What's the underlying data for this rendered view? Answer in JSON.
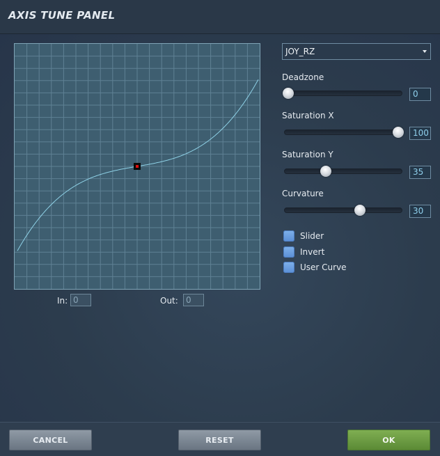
{
  "header": {
    "title": "AXIS TUNE PANEL"
  },
  "graph": {
    "in_label": "In:",
    "in_value": "0",
    "out_label": "Out:",
    "out_value": "0",
    "curve_color": "#8ed1e6",
    "marker_color": "#e01010"
  },
  "axis_select": {
    "selected": "JOY_RZ"
  },
  "params": [
    {
      "label": "Deadzone",
      "value": "0",
      "level": 0.03
    },
    {
      "label": "Saturation X",
      "value": "100",
      "level": 0.97
    },
    {
      "label": "Saturation Y",
      "value": "35",
      "level": 0.35
    },
    {
      "label": "Curvature",
      "value": "30",
      "level": 0.64
    }
  ],
  "options": [
    {
      "label": "Slider"
    },
    {
      "label": "Invert"
    },
    {
      "label": "User Curve"
    }
  ],
  "footer": {
    "cancel_label": "CANCEL",
    "reset_label": "RESET",
    "ok_label": "OK"
  }
}
